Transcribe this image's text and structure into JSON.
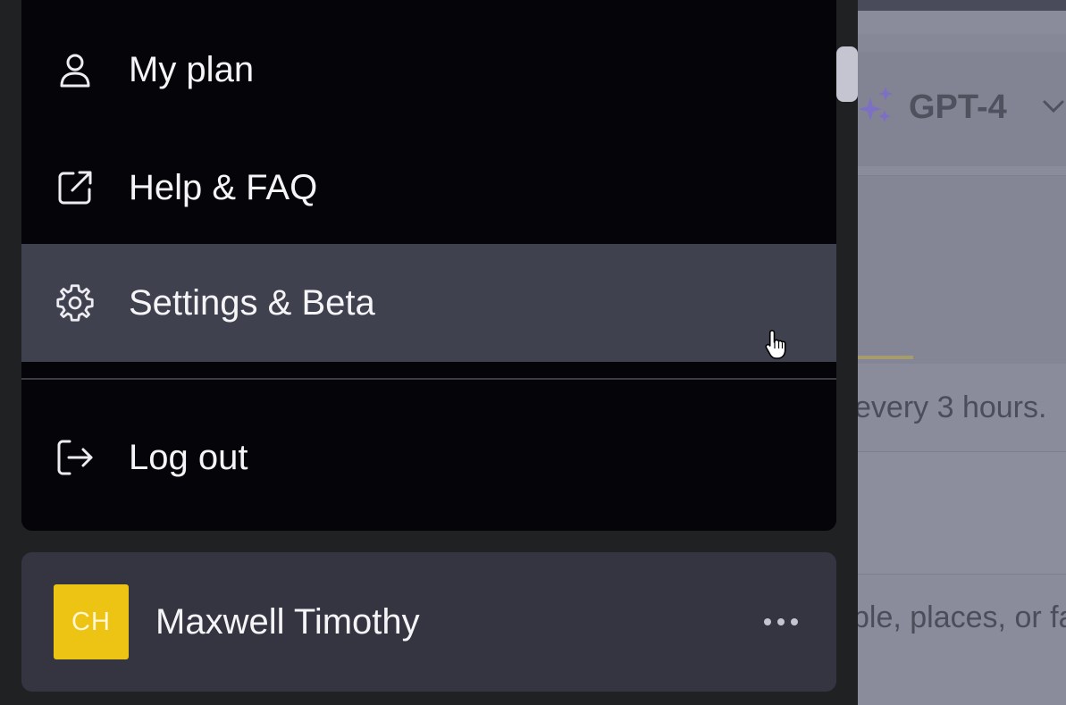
{
  "menu": {
    "items": [
      {
        "label": "My plan",
        "icon": "user-icon"
      },
      {
        "label": "Help & FAQ",
        "icon": "external-link-icon"
      },
      {
        "label": "Settings & Beta",
        "icon": "gear-icon"
      },
      {
        "label": "Log out",
        "icon": "logout-icon"
      }
    ]
  },
  "user": {
    "initials": "CH",
    "name": "Maxwell Timothy",
    "avatar_color": "#eec414",
    "more_icon": "more-horizontal-icon"
  },
  "main": {
    "model_label": "GPT-4",
    "model_icon": "sparkles-icon",
    "limit_text": "every 3 hours.",
    "prompt_text": "ple, places, or fa"
  },
  "colors": {
    "sidebar_bg": "#202123",
    "menu_bg": "#050509",
    "hover_bg": "#40414f",
    "accent_purple": "#7c6fc4"
  }
}
